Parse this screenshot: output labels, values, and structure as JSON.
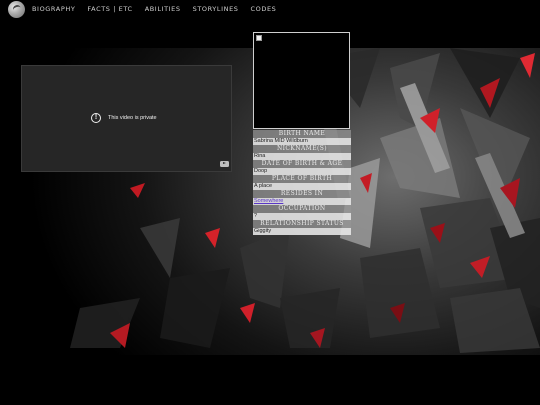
{
  "nav": {
    "items": [
      "BIOGRAPHY",
      "FACTS | ETC",
      "ABILITIES",
      "STORYLINES",
      "CODES"
    ]
  },
  "video": {
    "message": "This video is private"
  },
  "profile": {
    "fields": [
      {
        "label": "BIRTH NAME",
        "value": "Sabrina MID Wildburn"
      },
      {
        "label": "NICKNAME(S)",
        "value": "Rina"
      },
      {
        "label": "DATE OF BIRTH & AGE",
        "value": "Doop"
      },
      {
        "label": "PLACE OF BIRTH",
        "value": "A place"
      },
      {
        "label": "RESIDES IN",
        "value": "Somewhere"
      },
      {
        "label": "OCCUPATION",
        "value": "?"
      },
      {
        "label": "RELATIONSHIP STATUS",
        "value": "Giggity"
      }
    ]
  },
  "colors": {
    "background": "#000000",
    "accent_red": "#d0202a",
    "link": "#5a37c8"
  }
}
